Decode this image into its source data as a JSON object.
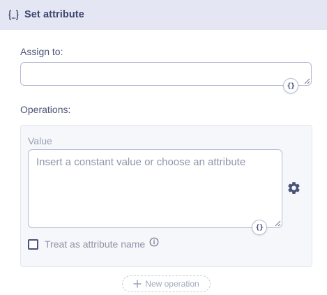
{
  "header": {
    "title": "Set attribute",
    "icon": "curly-braces-icon"
  },
  "assign": {
    "label": "Assign to:",
    "value": "",
    "expression_button": "{}"
  },
  "operations": {
    "label": "Operations:",
    "value_label": "Value",
    "value_placeholder": "Insert a constant value or choose an attribute",
    "expression_button": "{}",
    "settings_icon": "gear-icon",
    "treat_as_attribute_label": "Treat as attribute name",
    "treat_as_attribute_checked": false,
    "info_icon": "info-icon",
    "new_operation_label": "New operation"
  },
  "colors": {
    "header_bg": "#e4e7f3",
    "accent": "#4a5379",
    "panel_bg": "#f6f7fb"
  }
}
